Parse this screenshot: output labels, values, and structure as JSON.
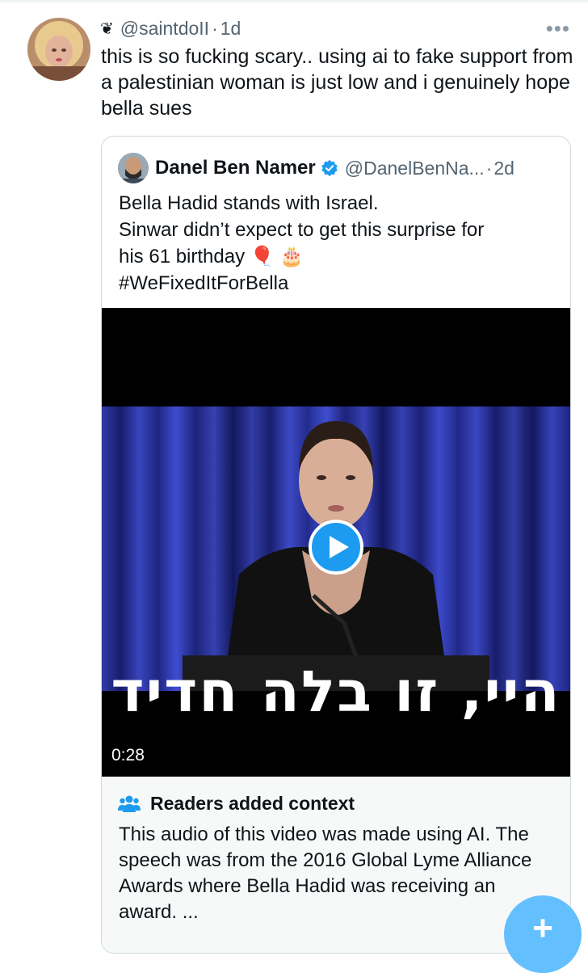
{
  "tweet": {
    "display_emoji": "❦",
    "handle": "@saintdoII",
    "separator": "·",
    "time": "1d",
    "more_label": "•••",
    "text": "this is so fucking scary.. using ai to fake support from a palestinian woman is just low and i genuinely hope bella sues"
  },
  "quote": {
    "name": "Danel Ben Namer",
    "handle": "@DanelBenNa...",
    "separator": "·",
    "time": "2d",
    "lines": [
      "Bella Hadid stands with Israel.",
      "Sinwar didn’t expect to get this surprise for",
      "his 61 birthday 🎈 🎂",
      "#WeFixedItForBella"
    ],
    "video": {
      "subtitle": "היי, זו בלה חדיד",
      "duration": "0:28"
    }
  },
  "context": {
    "title": "Readers added context",
    "body": "This audio of this video was made using AI. The speech was from the 2016 Global Lyme Alliance Awards where Bella Hadid was receiving an award.  ..."
  },
  "fab": {
    "label": "+"
  },
  "colors": {
    "accent": "#1d9bf0",
    "text": "#0f1419",
    "muted": "#536471",
    "fab": "#64bfff"
  }
}
